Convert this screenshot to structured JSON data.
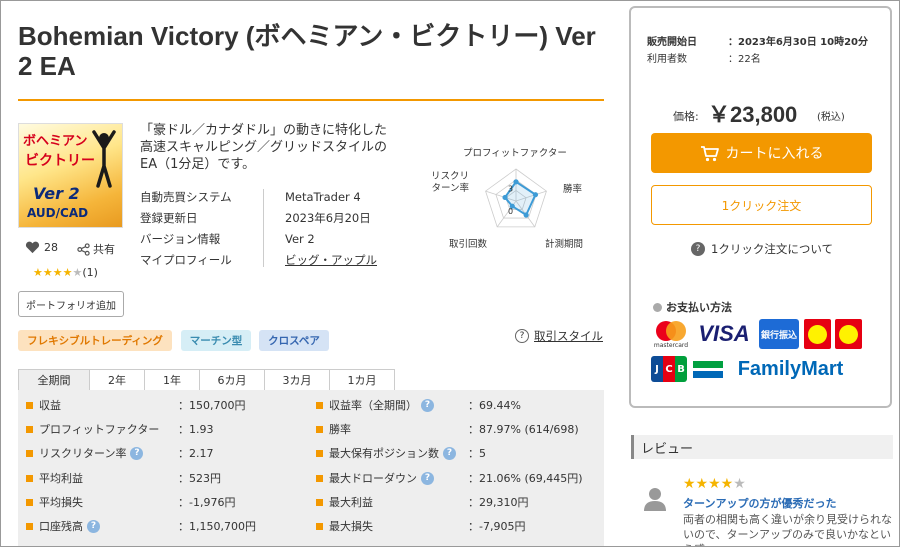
{
  "product": {
    "title": "Bohemian Victory (ボヘミアン・ビクトリー) Ver 2 EA",
    "thumbnail": {
      "line1": "ボヘミアン",
      "line2": "ビクトリー",
      "line3": "Ver 2",
      "line4": "AUD/CAD"
    },
    "likes": "28",
    "share_label": "共有",
    "rating": {
      "stars": 4,
      "max": 5,
      "count": "(1)"
    },
    "portfolio_button": "ポートフォリオ追加",
    "description": "「豪ドル／カナダドル」の動きに特化した高速スキャルピング／グリッドスタイルのEA（1分足）です。",
    "meta": [
      {
        "key": "自動売買システム",
        "value": "MetaTrader 4"
      },
      {
        "key": "登録更新日",
        "value": "2023年6月20日"
      },
      {
        "key": "バージョン情報",
        "value": "Ver 2"
      },
      {
        "key": "マイプロフィール",
        "value": "ビッグ・アップル"
      }
    ]
  },
  "radar": {
    "labels": [
      "プロフィットファクター",
      "勝率",
      "計測期間",
      "取引回数",
      "リスクリターン率"
    ],
    "scale_labels": [
      "3",
      "0"
    ],
    "values": [
      3,
      3.2,
      2.7,
      1,
      1.8
    ],
    "max": 5,
    "color": "#3d9bd6"
  },
  "tags": [
    "フレキシブルトレーディング",
    "マーチン型",
    "クロスペア"
  ],
  "trade_style_label": "取引スタイル",
  "tabs": [
    "全期間",
    "2年",
    "1年",
    "6カ月",
    "3カ月",
    "1カ月"
  ],
  "stats_left": [
    {
      "label": "収益",
      "value": "：150,700円",
      "help": false
    },
    {
      "label": "プロフィットファクター",
      "value": "：1.93",
      "help": false
    },
    {
      "label": "リスクリターン率",
      "value": "：2.17",
      "help": true
    },
    {
      "label": "平均利益",
      "value": "：523円",
      "help": false
    },
    {
      "label": "平均損失",
      "value": "：-1,976円",
      "help": false
    },
    {
      "label": "口座残高",
      "value": "：1,150,700円",
      "help": true
    }
  ],
  "stats_right": [
    {
      "label": "収益率（全期間）",
      "value": "：69.44%",
      "help": true
    },
    {
      "label": "勝率",
      "value": "：87.97% (614/698)",
      "help": false
    },
    {
      "label": "最大保有ポジション数",
      "value": "：5",
      "help": true
    },
    {
      "label": "最大ドローダウン",
      "value": "：21.06% (69,445円)",
      "help": true
    },
    {
      "label": "最大利益",
      "value": "：29,310円",
      "help": false
    },
    {
      "label": "最大損失",
      "value": "：-7,905円",
      "help": false
    }
  ],
  "buybox": {
    "release_label": "販売開始日",
    "release_value": "：2023年6月30日 10時20分",
    "users_label": "利用者数",
    "users_value": "：22名",
    "price_label": "価格:",
    "price": "￥23,800",
    "tax_label": "(税込)",
    "cart_button": "カートに入れる",
    "oneclick_button": "1クリック注文",
    "oneclick_about": "1クリック注文について",
    "payment_title": "お支払い方法",
    "payment": {
      "mastercard": "mastercard",
      "visa": "VISA",
      "bank": "銀行振込",
      "jcb": "JCB",
      "famima": "FamilyMart"
    }
  },
  "review": {
    "heading": "レビュー",
    "stars": 4,
    "title": "ターンアップの方が優秀だった",
    "body": "両者の相関も高く違いが余り見受けられないので、ターンアップのみで良いかなという感"
  },
  "colors": {
    "accent": "#f39800",
    "link": "#2a6bb5"
  }
}
